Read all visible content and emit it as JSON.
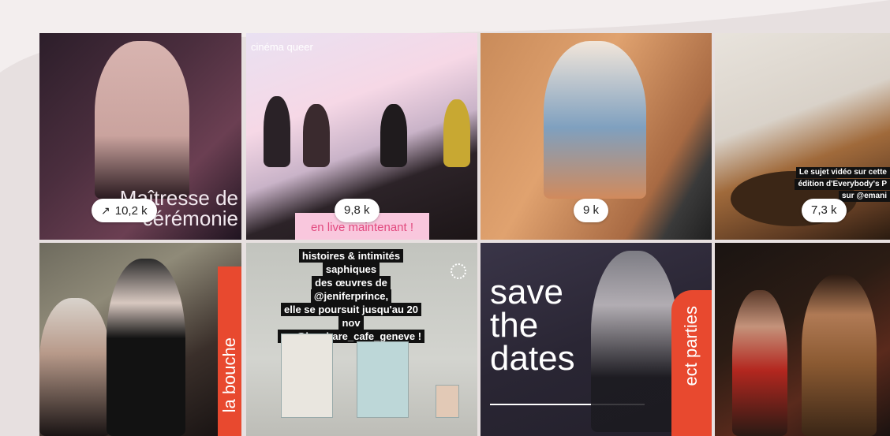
{
  "grid": {
    "tiles": [
      {
        "id": "t1",
        "badge": "10,2 k",
        "trend_icon": "trending-up-icon",
        "overlay_line1": "Maîtresse de",
        "overlay_line2": "cérémonie"
      },
      {
        "id": "t2",
        "badge": "9,8 k",
        "label_top": "cinéma queer",
        "banner": "en live maintenant !"
      },
      {
        "id": "t3",
        "badge": "9 k"
      },
      {
        "id": "t4",
        "badge": "7,3 k",
        "caption_line1": "Le sujet vidéo sur cette",
        "caption_line2": "édition d'Everybody's P",
        "caption_line3": "sur @emani"
      },
      {
        "id": "t5",
        "vertical_text": "la bouche"
      },
      {
        "id": "t6",
        "story_lines": [
          "histoires & intimités saphiques",
          "des œuvres de @jeniferprince,",
          "elle se poursuit jusqu'au 20 nov",
          "au @le_phare_cafe_geneve !"
        ]
      },
      {
        "id": "t7",
        "headline_lines": [
          "save",
          "the",
          "dates"
        ],
        "vertical_text": "ect parties"
      },
      {
        "id": "t8"
      }
    ]
  },
  "colors": {
    "background": "#f3eeee",
    "accent_orange": "#e8492f",
    "banner_pink": "#f9c7dd"
  }
}
